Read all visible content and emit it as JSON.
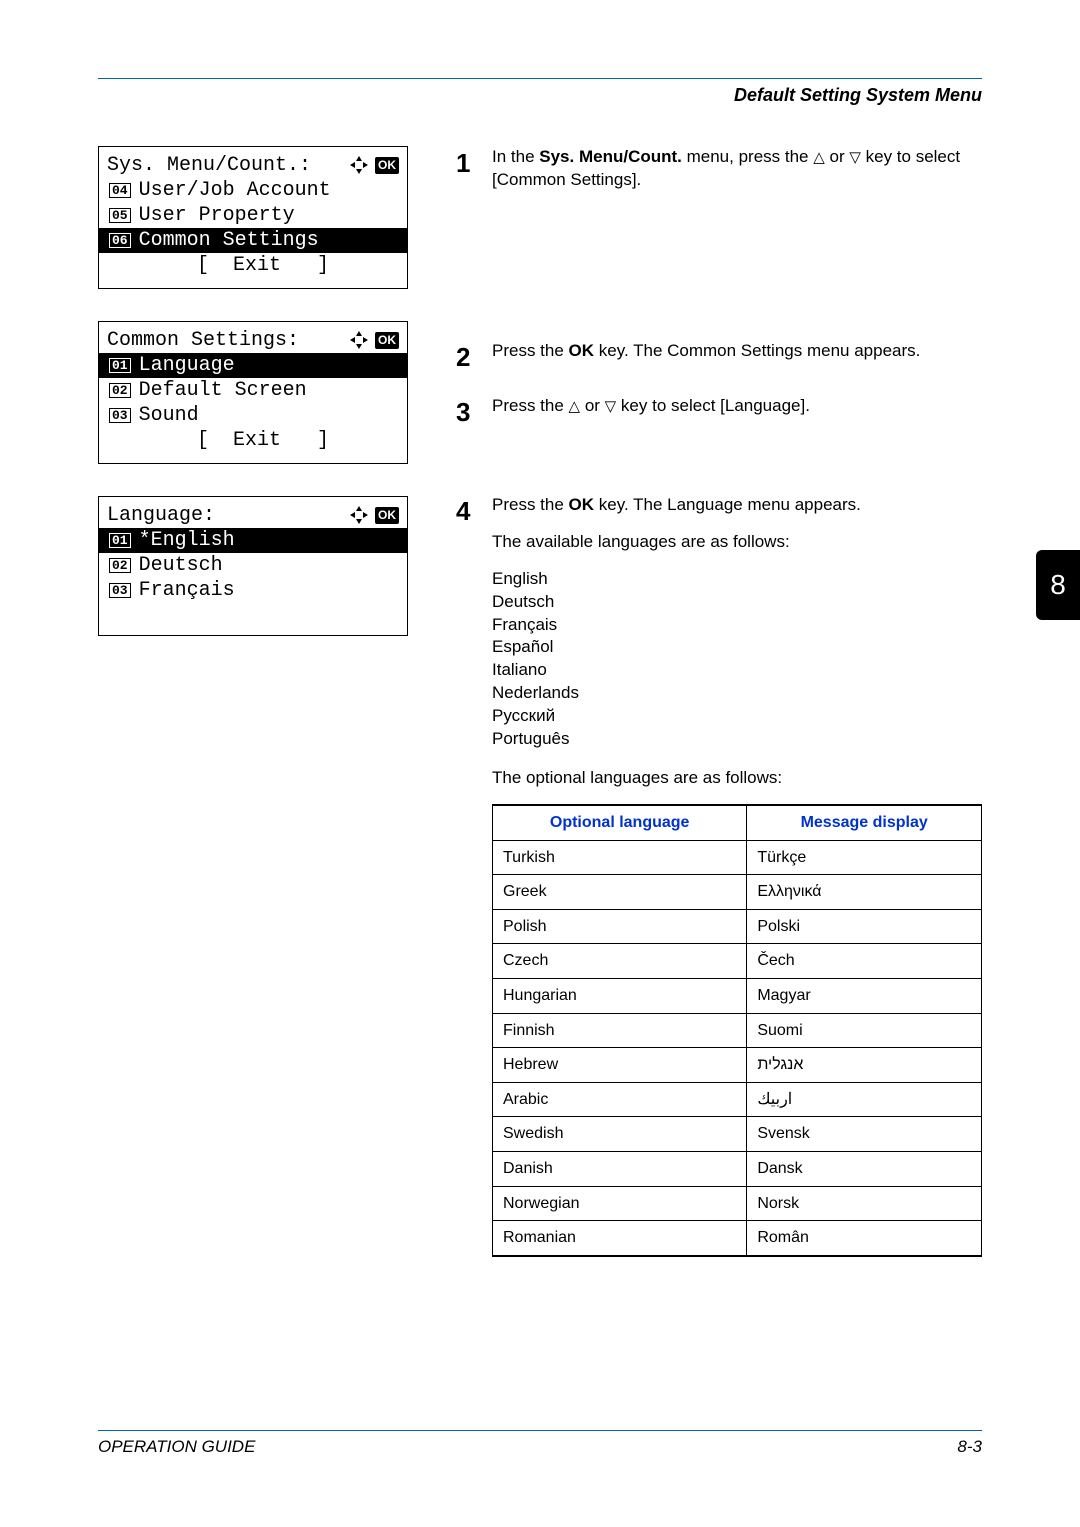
{
  "header": {
    "section_title": "Default Setting System Menu"
  },
  "chapter_tab": "8",
  "lcd_panels": [
    {
      "title": "Sys. Menu/Count.:",
      "rows": [
        {
          "num": "04",
          "label": "User/Job Account",
          "selected": false
        },
        {
          "num": "05",
          "label": "User Property",
          "selected": false
        },
        {
          "num": "06",
          "label": "Common Settings",
          "selected": true
        }
      ],
      "exit": "[  Exit   ]"
    },
    {
      "title": "Common Settings:",
      "rows": [
        {
          "num": "01",
          "label": "Language",
          "selected": true
        },
        {
          "num": "02",
          "label": "Default Screen",
          "selected": false
        },
        {
          "num": "03",
          "label": "Sound",
          "selected": false
        }
      ],
      "exit": "[  Exit   ]"
    },
    {
      "title": "Language:",
      "rows": [
        {
          "num": "01",
          "label": "*English",
          "selected": true
        },
        {
          "num": "02",
          "label": "Deutsch",
          "selected": false
        },
        {
          "num": "03",
          "label": "Français",
          "selected": false
        }
      ],
      "exit": ""
    }
  ],
  "steps": {
    "s1": {
      "num": "1",
      "body_pre": "In the ",
      "bold1": "Sys. Menu/Count.",
      "body_mid": " menu, press the ",
      "body_post": " key to select [Common Settings]."
    },
    "s2": {
      "num": "2",
      "body_pre": "Press the ",
      "bold1": "OK",
      "body_post": " key. The Common Settings menu appears."
    },
    "s3": {
      "num": "3",
      "body_pre": "Press the ",
      "body_post": " key to select [Language]."
    },
    "s4": {
      "num": "4",
      "line1_pre": "Press the ",
      "line1_bold": "OK",
      "line1_post": " key. The Language menu appears.",
      "line2": "The available languages are as follows:",
      "languages": [
        "English",
        "Deutsch",
        "Français",
        "Español",
        "Italiano",
        "Nederlands",
        "Русский",
        "Português"
      ],
      "line3": "The optional languages are as follows:"
    }
  },
  "table": {
    "headers": {
      "col1": "Optional language",
      "col2": "Message display"
    },
    "rows": [
      {
        "c1": "Turkish",
        "c2": "Türkçe",
        "rtl": false
      },
      {
        "c1": "Greek",
        "c2": "Ελληνικά",
        "rtl": false
      },
      {
        "c1": "Polish",
        "c2": "Polski",
        "rtl": false
      },
      {
        "c1": "Czech",
        "c2": "Čech",
        "rtl": false
      },
      {
        "c1": "Hungarian",
        "c2": "Magyar",
        "rtl": false
      },
      {
        "c1": "Finnish",
        "c2": "Suomi",
        "rtl": false
      },
      {
        "c1": "Hebrew",
        "c2": "אנגלית",
        "rtl": true
      },
      {
        "c1": "Arabic",
        "c2": "اربيك",
        "rtl": true
      },
      {
        "c1": "Swedish",
        "c2": "Svensk",
        "rtl": false
      },
      {
        "c1": "Danish",
        "c2": "Dansk",
        "rtl": false
      },
      {
        "c1": "Norwegian",
        "c2": "Norsk",
        "rtl": false
      },
      {
        "c1": "Romanian",
        "c2": "Român",
        "rtl": false
      }
    ]
  },
  "footer": {
    "left": "OPERATION GUIDE",
    "right": "8-3"
  }
}
